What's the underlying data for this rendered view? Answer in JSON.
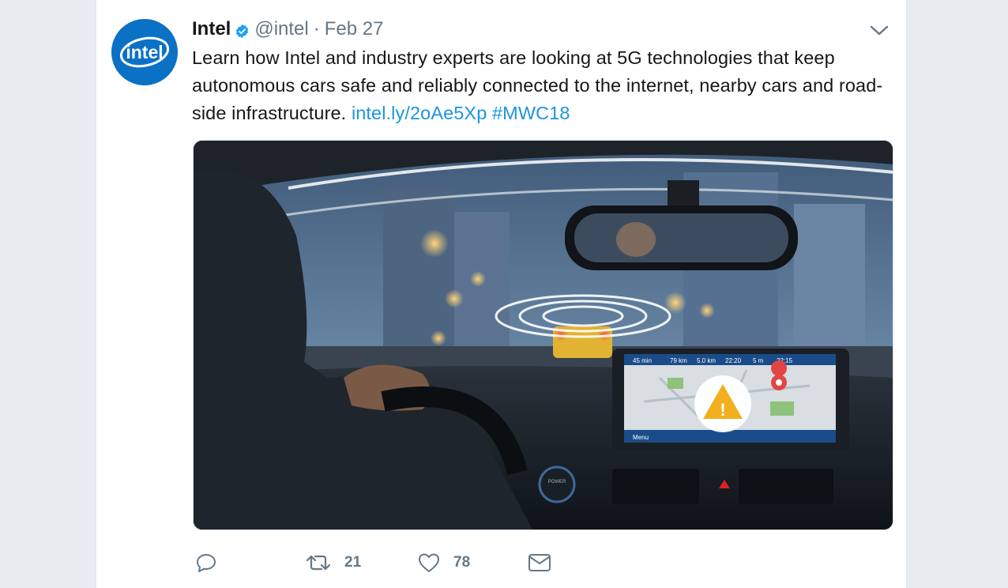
{
  "tweet": {
    "author_name": "Intel",
    "verified": true,
    "handle": "@intel",
    "separator": "·",
    "date": "Feb 27",
    "avatar_text": "intel",
    "text": "Learn how Intel and industry experts are looking at 5G technologies that keep autonomous cars safe and reliably connected to the internet, nearby cars and road-side infrastructure. ",
    "link": "intel.ly/2oAe5Xp",
    "hashtag": "#MWC18",
    "media": {
      "screen_labels": [
        "45 min",
        "79 km",
        "5.0 km",
        "22:20",
        "5 m",
        "22:15"
      ],
      "menu_label": "Menu",
      "power_label": "POWER"
    }
  },
  "actions": {
    "reply_icon": "reply-icon",
    "retweet_icon": "retweet-icon",
    "retweet_count": "21",
    "like_icon": "heart-icon",
    "like_count": "78",
    "dm_icon": "envelope-icon"
  },
  "colors": {
    "background": "#e6ecf0",
    "link": "#1b95e0",
    "secondary_text": "#657786",
    "intel_blue": "#0a71c5"
  }
}
